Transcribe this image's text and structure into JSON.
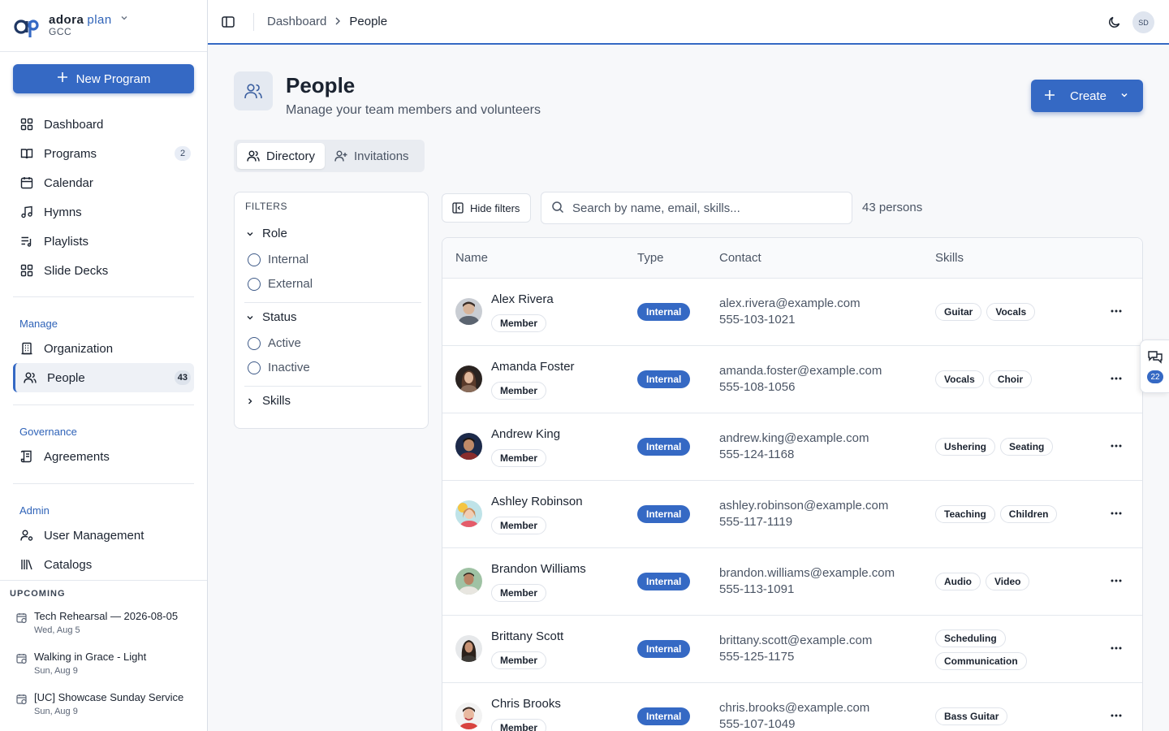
{
  "brand": {
    "name_part1": "adora",
    "name_part2": "plan",
    "org": "GCC"
  },
  "sidebar": {
    "new_program_label": "New Program",
    "main_items": [
      {
        "label": "Dashboard",
        "icon": "grid-icon"
      },
      {
        "label": "Programs",
        "icon": "book-open-icon",
        "count": "2"
      },
      {
        "label": "Calendar",
        "icon": "calendar-icon"
      },
      {
        "label": "Hymns",
        "icon": "music-note-icon"
      },
      {
        "label": "Playlists",
        "icon": "list-music-icon"
      },
      {
        "label": "Slide Decks",
        "icon": "grid-icon"
      }
    ],
    "manage_label": "Manage",
    "manage_items": [
      {
        "label": "Organization",
        "icon": "building-icon"
      },
      {
        "label": "People",
        "icon": "users-icon",
        "count": "43"
      }
    ],
    "governance_label": "Governance",
    "governance_items": [
      {
        "label": "Agreements",
        "icon": "scroll-icon"
      }
    ],
    "admin_label": "Admin",
    "admin_items": [
      {
        "label": "User Management",
        "icon": "user-cog-icon"
      },
      {
        "label": "Catalogs",
        "icon": "library-icon"
      }
    ],
    "upcoming_title": "UPCOMING",
    "upcoming": [
      {
        "title": "Tech Rehearsal — 2026-08-05",
        "date": "Wed, Aug 5"
      },
      {
        "title": "Walking in Grace - Light",
        "date": "Sun, Aug 9"
      },
      {
        "title": "[UC] Showcase Sunday Service",
        "date": "Sun, Aug 9"
      }
    ]
  },
  "topbar": {
    "breadcrumb": [
      "Dashboard",
      "People"
    ],
    "avatar_initials": "SD"
  },
  "page": {
    "title": "People",
    "subtitle": "Manage your team members and volunteers",
    "create_label": "Create"
  },
  "tabs": [
    {
      "label": "Directory",
      "active": true
    },
    {
      "label": "Invitations",
      "active": false
    }
  ],
  "filters": {
    "title": "FILTERS",
    "role_label": "Role",
    "role_options": [
      "Internal",
      "External"
    ],
    "status_label": "Status",
    "status_options": [
      "Active",
      "Inactive"
    ],
    "skills_label": "Skills"
  },
  "toolbar": {
    "hide_filters_label": "Hide filters",
    "search_placeholder": "Search by name, email, skills...",
    "person_count": "43 persons"
  },
  "table": {
    "headers": [
      "Name",
      "Type",
      "Contact",
      "Skills"
    ],
    "rows": [
      {
        "name": "Alex Rivera",
        "role": "Member",
        "type": "Internal",
        "email": "alex.rivera@example.com",
        "phone": "555-103-1021",
        "skills": [
          "Guitar",
          "Vocals"
        ]
      },
      {
        "name": "Amanda Foster",
        "role": "Member",
        "type": "Internal",
        "email": "amanda.foster@example.com",
        "phone": "555-108-1056",
        "skills": [
          "Vocals",
          "Choir"
        ]
      },
      {
        "name": "Andrew King",
        "role": "Member",
        "type": "Internal",
        "email": "andrew.king@example.com",
        "phone": "555-124-1168",
        "skills": [
          "Ushering",
          "Seating"
        ]
      },
      {
        "name": "Ashley Robinson",
        "role": "Member",
        "type": "Internal",
        "email": "ashley.robinson@example.com",
        "phone": "555-117-1119",
        "skills": [
          "Teaching",
          "Children"
        ]
      },
      {
        "name": "Brandon Williams",
        "role": "Member",
        "type": "Internal",
        "email": "brandon.williams@example.com",
        "phone": "555-113-1091",
        "skills": [
          "Audio",
          "Video"
        ]
      },
      {
        "name": "Brittany Scott",
        "role": "Member",
        "type": "Internal",
        "email": "brittany.scott@example.com",
        "phone": "555-125-1175",
        "skills": [
          "Scheduling",
          "Communication"
        ]
      },
      {
        "name": "Chris Brooks",
        "role": "Member",
        "type": "Internal",
        "email": "chris.brooks@example.com",
        "phone": "555-107-1049",
        "skills": [
          "Bass Guitar"
        ]
      }
    ]
  },
  "chat_float": {
    "count": "22"
  },
  "colors": {
    "accent": "#3569c4",
    "section_label": "#2f63b8"
  }
}
